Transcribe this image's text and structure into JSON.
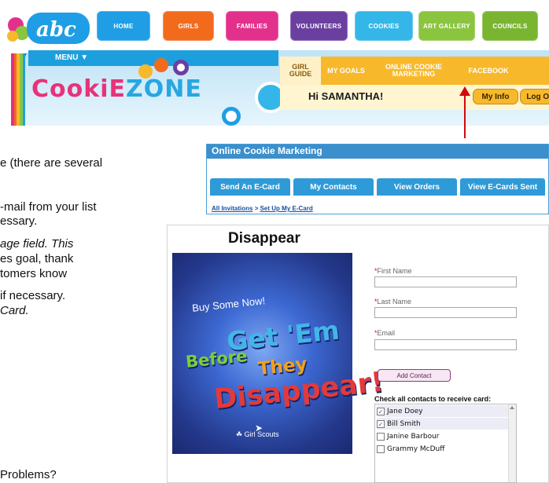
{
  "site": {
    "logo_text": "abc"
  },
  "nav": {
    "tabs": [
      {
        "label": "HOME",
        "color": "#1f9ee6"
      },
      {
        "label": "GIRLS",
        "color": "#f26b1d"
      },
      {
        "label": "FAMILIES",
        "color": "#e3308c"
      },
      {
        "label": "VOLUNTEERS",
        "color": "#6b3fa0"
      },
      {
        "label": "COOKIES",
        "color": "#34b7e8"
      },
      {
        "label": "ART GALLERY",
        "color": "#8bc53f"
      },
      {
        "label": "COUNCILS",
        "color": "#7ab532"
      }
    ]
  },
  "zone": {
    "menu_label": "MENU ▼",
    "title_part1": "CookiE",
    "title_part2": "ZONE",
    "tabs": {
      "girl_guide": "GIRL GUIDE",
      "my_goals": "MY GOALS",
      "online_cookie": "ONLINE COOKIE MARKETING",
      "facebook": "FACEBOOK"
    },
    "greeting": "Hi SAMANTHA!",
    "my_info": "My Info",
    "log_out": "Log Out",
    "stripe_colors": [
      "#e3308c",
      "#f26b1d",
      "#f7b92b",
      "#8bc53f",
      "#1f9ee6",
      "#6b3fa0"
    ]
  },
  "doc_text": {
    "line1": "e (there are several",
    "line2": "-mail from your list",
    "line3": "essary.",
    "line4": "age field.  This",
    "line5": "es goal, thank",
    "line6": "tomers know",
    "line7": "if necessary.",
    "line8": "Card.",
    "line9": "Problems?"
  },
  "ocm": {
    "title": "Online Cookie Marketing",
    "tabs": [
      "Send An E-Card",
      "My Contacts",
      "View Orders",
      "View E-Cards Sent"
    ],
    "crumb_all": "All Invitations",
    "crumb_sep": ">",
    "crumb_current": "Set Up My E-Card"
  },
  "ecard": {
    "title": "Disappear",
    "image": {
      "buy_text": "Buy Some Now!",
      "word1": "Get 'Em",
      "word2": "Before",
      "word3": "They",
      "word4": "Disappear!",
      "brand": "Girl Scouts"
    }
  },
  "form": {
    "first_name_label": "First Name",
    "last_name_label": "Last Name",
    "email_label": "Email",
    "required_mark": "*",
    "add_contact_button": "Add Contact",
    "contacts_heading": "Check all contacts to receive card:",
    "contacts": [
      {
        "name": "Jane Doey",
        "checked": true
      },
      {
        "name": "Bill Smith",
        "checked": true
      },
      {
        "name": "Janine Barbour",
        "checked": false
      },
      {
        "name": "Grammy McDuff",
        "checked": false
      }
    ]
  }
}
